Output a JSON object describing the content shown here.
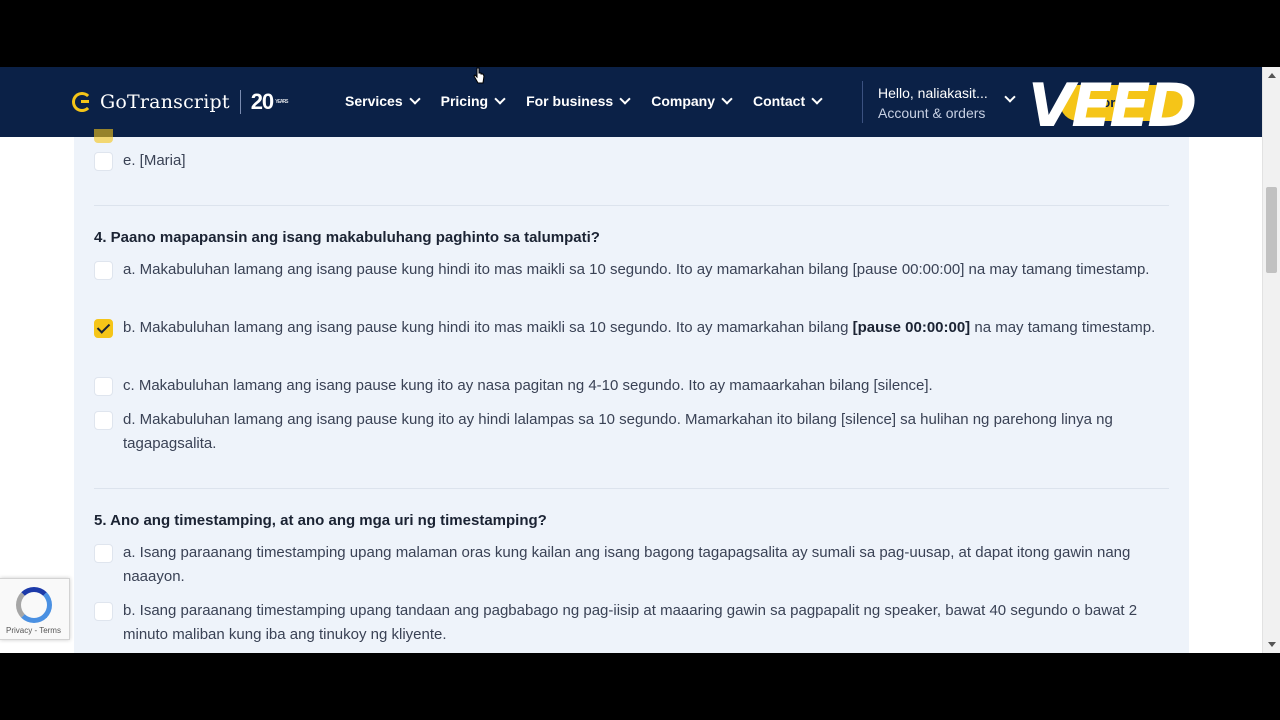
{
  "header": {
    "logo_text": "GoTranscript",
    "logo_20": "20",
    "logo_years": "YEARS",
    "nav": [
      {
        "label": "Services"
      },
      {
        "label": "Pricing"
      },
      {
        "label": "For business"
      },
      {
        "label": "Company"
      },
      {
        "label": "Contact"
      }
    ],
    "account_hello": "Hello, naliakasit...",
    "account_orders": "Account & orders",
    "cta_label": "orders",
    "watermark": "VEED"
  },
  "content": {
    "prev_option": {
      "text": "e. [Maria]",
      "checked": false
    },
    "q4": {
      "question": "4. Paano mapapansin ang isang makabuluhang paghinto sa talumpati?",
      "options": [
        {
          "text": "a. Makabuluhan lamang ang isang pause kung hindi ito mas maikli sa 10 segundo. Ito ay mamarkahan bilang [pause 00:00:00] na may tamang timestamp.",
          "checked": false
        },
        {
          "text_pre": "b. Makabuluhan lamang ang isang pause kung hindi ito mas maikli sa 10 segundo. Ito ay mamarkahan bilang ",
          "text_bold": "[pause 00:00:00]",
          "text_post": " na may tamang timestamp.",
          "checked": true
        },
        {
          "text": "c. Makabuluhan lamang ang isang pause kung ito ay nasa pagitan ng 4-10 segundo. Ito ay mamaarkahan bilang [silence].",
          "checked": false
        },
        {
          "text": "d. Makabuluhan lamang ang isang pause kung ito ay hindi lalampas sa 10 segundo. Mamarkahan ito bilang [silence] sa hulihan ng parehong linya ng tagapagsalita.",
          "checked": false
        }
      ]
    },
    "q5": {
      "question": "5. Ano ang timestamping, at ano ang mga uri ng timestamping?",
      "options": [
        {
          "text": "a. Isang paraanang timestamping upang malaman oras kung kailan ang isang bagong tagapagsalita ay sumali sa pag-uusap, at dapat itong gawin nang naaayon.",
          "checked": false
        },
        {
          "text": "b. Isang paraanang timestamping upang tandaan ang pagbabago ng pag-iisip at maaaring gawin sa pagpapalit ng speaker, bawat 40 segundo o bawat 2 minuto maliban kung iba ang tinukoy ng kliyente.",
          "checked": false
        }
      ]
    }
  },
  "recaptcha": {
    "footer": "Privacy - Terms"
  },
  "colors": {
    "header_bg": "#0b2147",
    "accent": "#f5c518",
    "content_bg": "#eef3fa"
  }
}
